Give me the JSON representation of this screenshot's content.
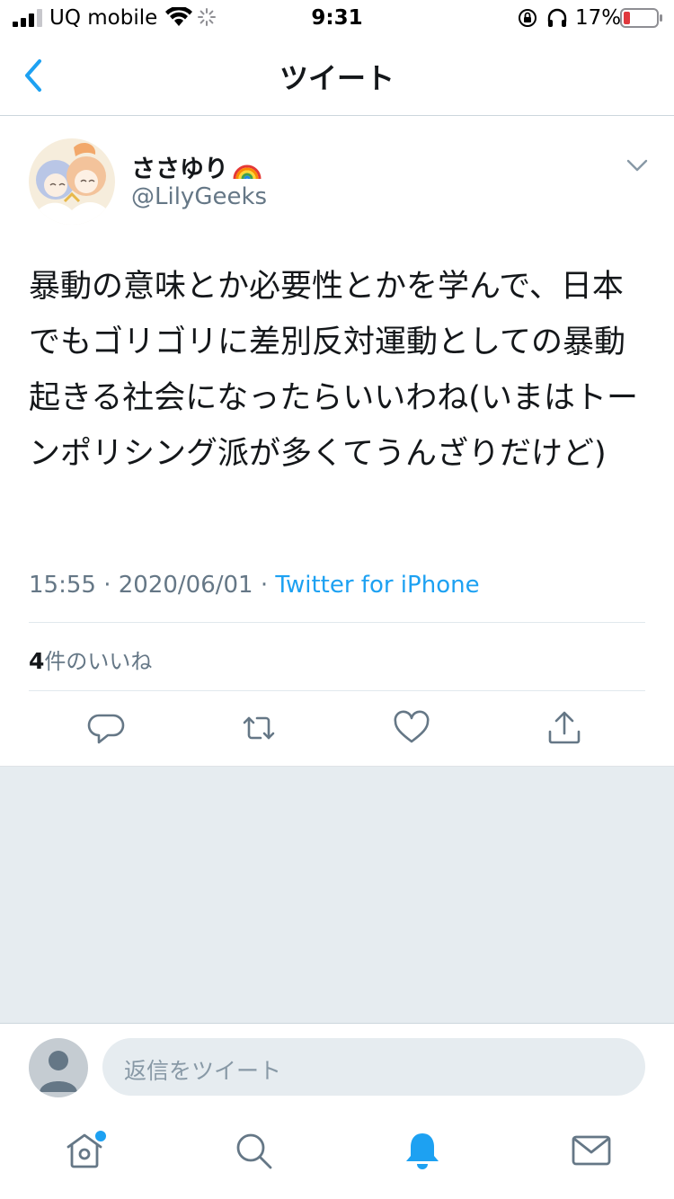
{
  "status_bar": {
    "carrier": "UQ mobile",
    "time": "9:31",
    "battery_percent": "17%"
  },
  "nav": {
    "title": "ツイート"
  },
  "tweet": {
    "user_name": "ささゆり",
    "user_handle": "@LilyGeeks",
    "text": "暴動の意味とか必要性とかを学んで、日本でもゴリゴリに差別反対運動としての暴動起きる社会になったらいいわね(いまはトーンポリシング派が多くてうんざりだけど)",
    "time": "15:55",
    "separator": "·",
    "date": "2020/06/01",
    "source": "Twitter for iPhone",
    "likes_count": "4",
    "likes_label": "件のいいね"
  },
  "reply": {
    "placeholder": "返信をツイート"
  },
  "colors": {
    "accent": "#1da1f2",
    "secondary_text": "#657786",
    "background_gray": "#e6ecf0",
    "battery_low": "#e0393e"
  },
  "icons": {
    "actions": [
      "reply-icon",
      "retweet-icon",
      "like-icon",
      "share-icon"
    ],
    "tabs": [
      "home-icon",
      "search-icon",
      "notifications-icon",
      "messages-icon"
    ]
  }
}
